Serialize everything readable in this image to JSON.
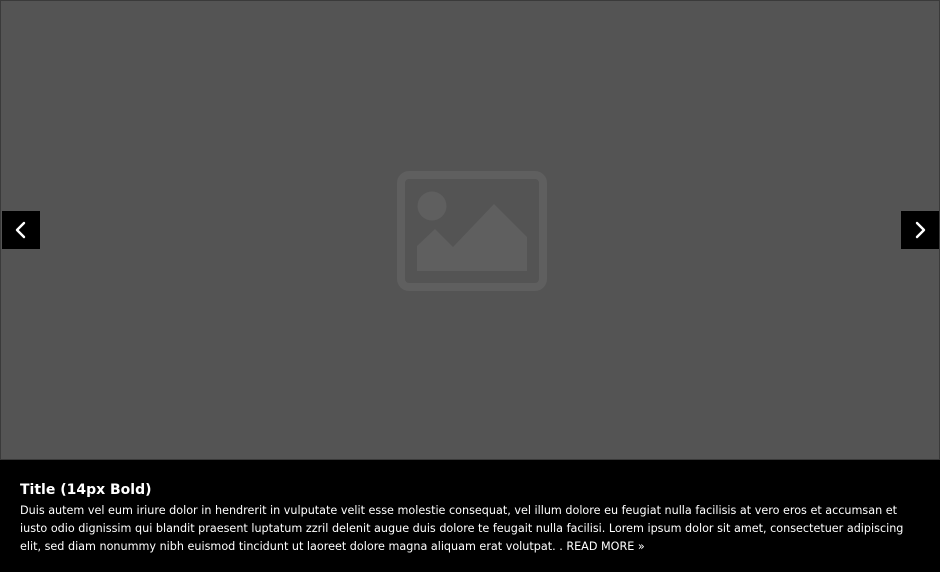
{
  "slider": {
    "image": {
      "icon": "image-placeholder-icon",
      "background_color": "#545454"
    },
    "prev_button": {
      "icon": "chevron-left-icon"
    },
    "next_button": {
      "icon": "chevron-right-icon"
    },
    "caption": {
      "title": "Title (14px Bold)",
      "text": "Duis autem vel eum iriure dolor in hendrerit in vulputate velit esse molestie consequat, vel illum dolore eu feugiat nulla facilisis at vero eros et accumsan et iusto odio dignissim qui blandit praesent luptatum zzril delenit augue duis dolore te feugait nulla facilisi. Lorem ipsum dolor sit amet, consectetuer adipiscing elit, sed diam nonummy nibh euismod tincidunt ut laoreet dolore magna aliquam erat volutpat. .",
      "read_more_label": "READ MORE »"
    }
  }
}
